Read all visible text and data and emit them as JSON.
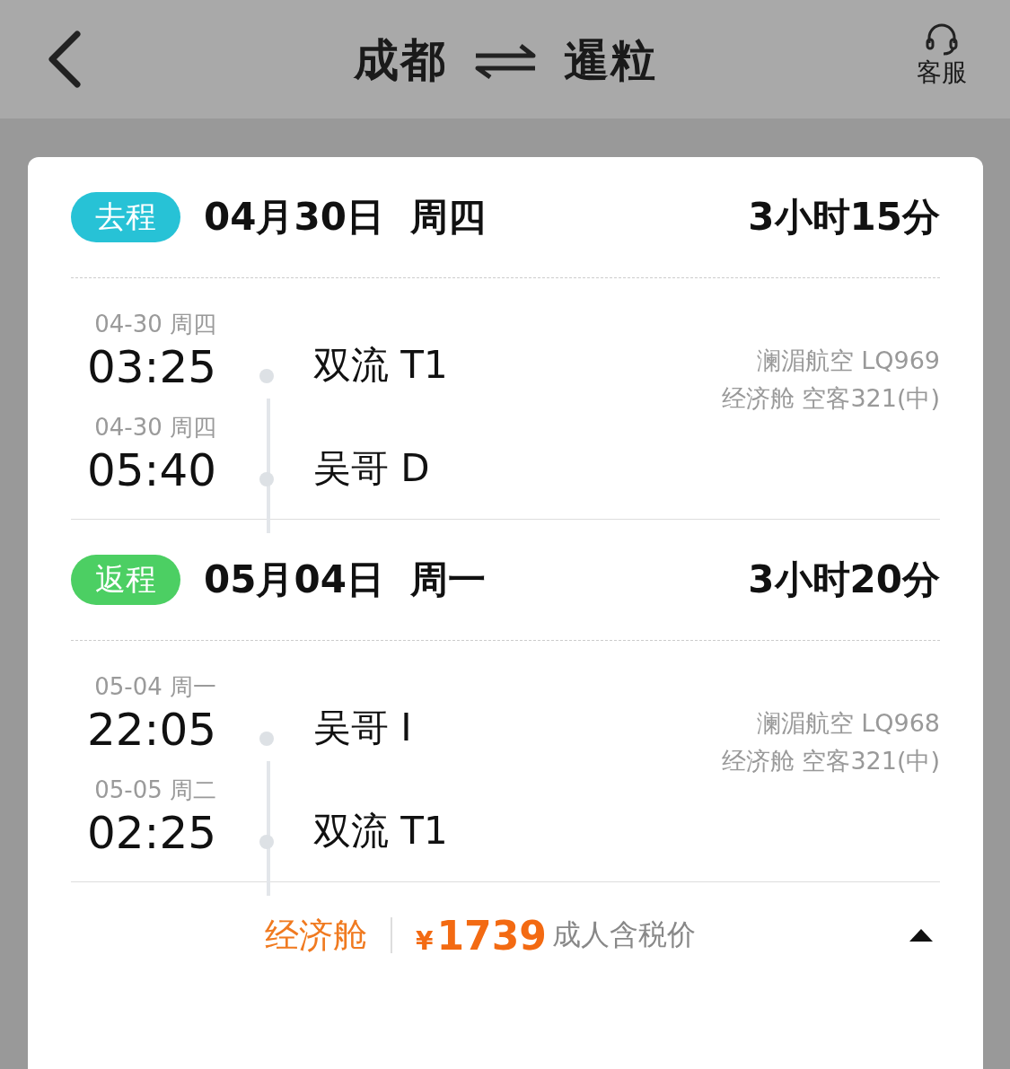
{
  "header": {
    "from": "成都",
    "to": "暹粒",
    "service": "客服"
  },
  "legs": [
    {
      "badge": "去程",
      "color": "#27c2d6",
      "date": "04月30日  周四",
      "duration": "3小时15分",
      "depart": {
        "date": "04-30 周四",
        "time": "03:25",
        "airport": "双流 T1"
      },
      "arrive": {
        "date": "04-30 周四",
        "time": "05:40",
        "airport": "吴哥 D"
      },
      "flight": "澜湄航空 LQ969",
      "cabin": "经济舱 空客321(中)"
    },
    {
      "badge": "返程",
      "color": "#4ccf63",
      "date": "05月04日  周一",
      "duration": "3小时20分",
      "depart": {
        "date": "05-04 周一",
        "time": "22:05",
        "airport": "吴哥 I"
      },
      "arrive": {
        "date": "05-05 周二",
        "time": "02:25",
        "airport": "双流 T1"
      },
      "flight": "澜湄航空 LQ968",
      "cabin": "经济舱 空客321(中)"
    }
  ],
  "footer": {
    "cabin": "经济舱",
    "currency": "¥",
    "price": "1739",
    "note": "成人含税价"
  }
}
